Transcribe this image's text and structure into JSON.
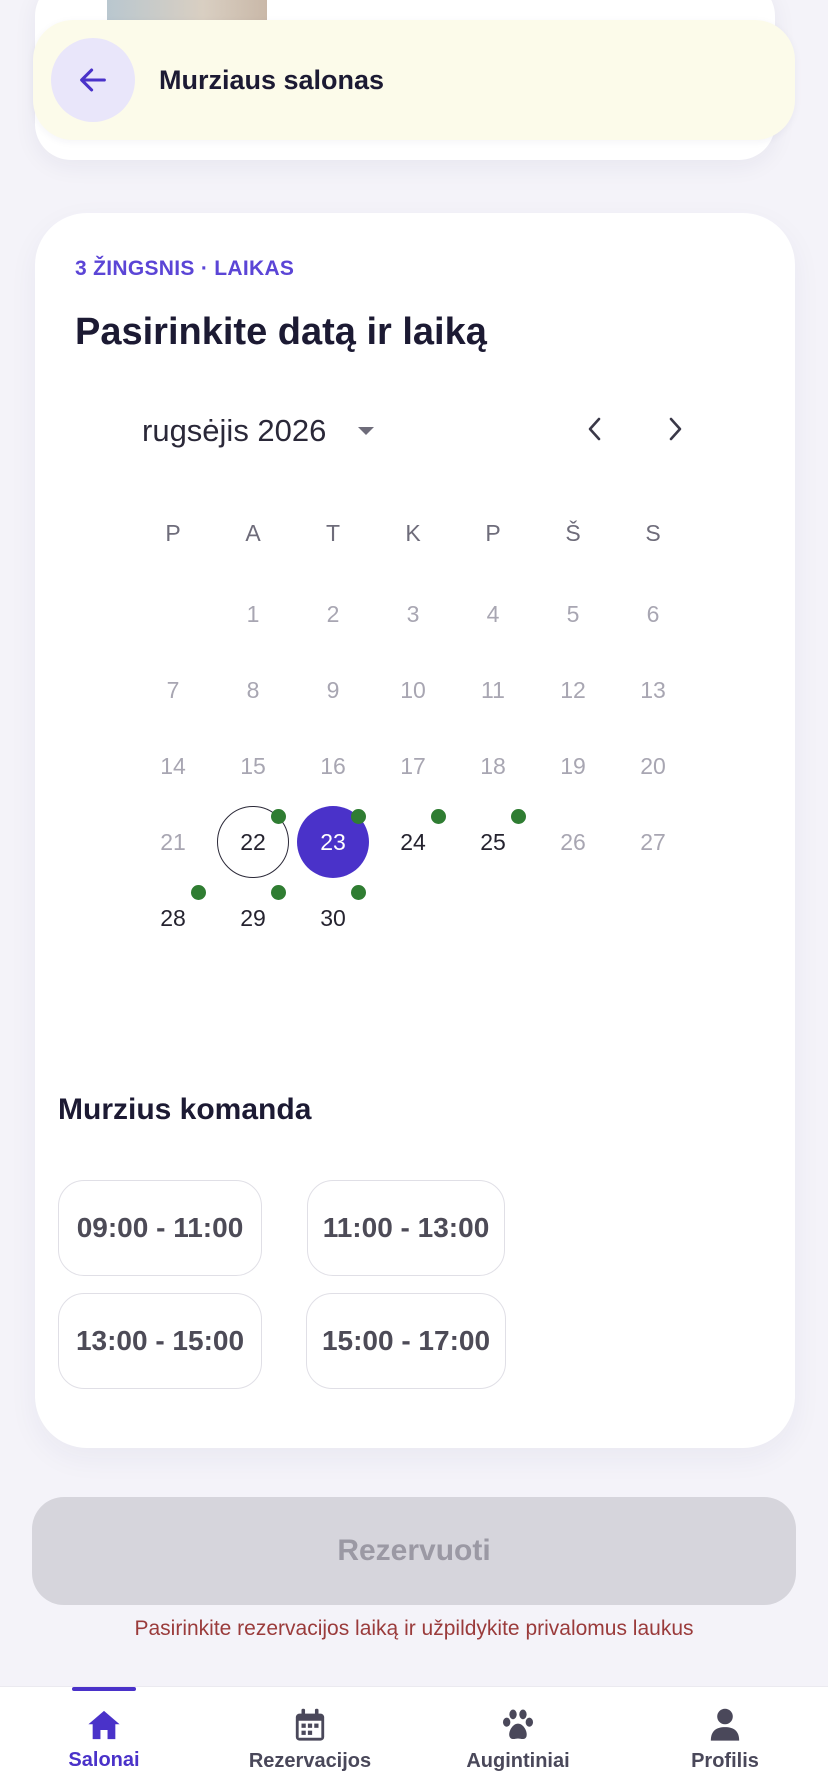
{
  "header": {
    "title": "Murziaus salonas"
  },
  "step": {
    "label": "3 ŽINGSNIS · LAIKAS",
    "title": "Pasirinkite datą ir laiką"
  },
  "calendar": {
    "month_label": "rugsėjis 2026",
    "weekdays": [
      "P",
      "A",
      "T",
      "K",
      "P",
      "Š",
      "S"
    ],
    "days": [
      {
        "d": "1",
        "state": "muted"
      },
      {
        "d": "2",
        "state": "muted"
      },
      {
        "d": "3",
        "state": "muted"
      },
      {
        "d": "4",
        "state": "muted"
      },
      {
        "d": "5",
        "state": "muted"
      },
      {
        "d": "6",
        "state": "muted"
      },
      {
        "d": "7",
        "state": "muted"
      },
      {
        "d": "8",
        "state": "muted"
      },
      {
        "d": "9",
        "state": "muted"
      },
      {
        "d": "10",
        "state": "muted"
      },
      {
        "d": "11",
        "state": "muted"
      },
      {
        "d": "12",
        "state": "muted"
      },
      {
        "d": "13",
        "state": "muted"
      },
      {
        "d": "14",
        "state": "muted"
      },
      {
        "d": "15",
        "state": "muted"
      },
      {
        "d": "16",
        "state": "muted"
      },
      {
        "d": "17",
        "state": "muted"
      },
      {
        "d": "18",
        "state": "muted"
      },
      {
        "d": "19",
        "state": "muted"
      },
      {
        "d": "20",
        "state": "muted"
      },
      {
        "d": "21",
        "state": "muted"
      },
      {
        "d": "22",
        "state": "today",
        "available": true
      },
      {
        "d": "23",
        "state": "selected",
        "available": true
      },
      {
        "d": "24",
        "state": "avail",
        "available": true
      },
      {
        "d": "25",
        "state": "avail",
        "available": true
      },
      {
        "d": "26",
        "state": "muted"
      },
      {
        "d": "27",
        "state": "muted"
      },
      {
        "d": "28",
        "state": "avail",
        "available": true
      },
      {
        "d": "29",
        "state": "avail",
        "available": true
      },
      {
        "d": "30",
        "state": "avail",
        "available": true
      }
    ],
    "first_weekday_index": 1,
    "selected_color": "#4a32c9",
    "availability_dot_color": "#2f7d32"
  },
  "team": {
    "title": "Murzius komanda",
    "slots": [
      "09:00 - 11:00",
      "11:00 - 13:00",
      "13:00 - 15:00",
      "15:00 - 17:00"
    ]
  },
  "reserve": {
    "label": "Rezervuoti",
    "hint": "Pasirinkite rezervacijos laiką ir užpildykite privalomus laukus"
  },
  "bottom_nav": {
    "items": [
      {
        "label": "Salonai",
        "icon": "home-icon",
        "active": true
      },
      {
        "label": "Rezervacijos",
        "icon": "calendar-icon",
        "active": false
      },
      {
        "label": "Augintiniai",
        "icon": "paw-icon",
        "active": false
      },
      {
        "label": "Profilis",
        "icon": "person-icon",
        "active": false
      }
    ]
  }
}
